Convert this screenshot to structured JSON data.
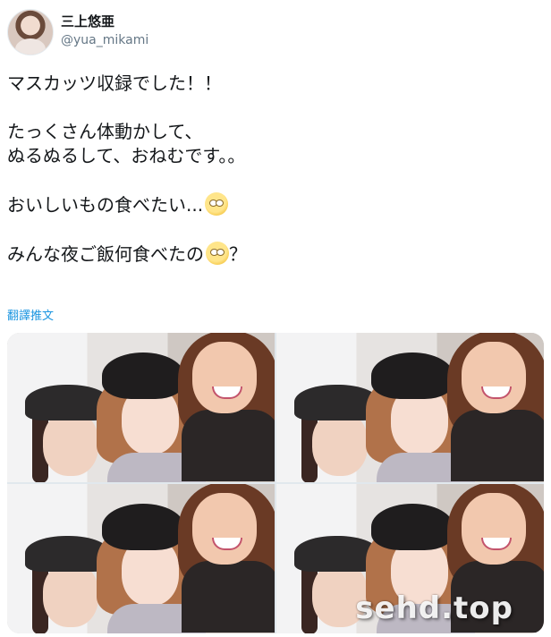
{
  "tweet": {
    "author_name": "三上悠亜",
    "author_handle": "@yua_mikami",
    "lines": [
      "マスカッツ収録でした！！",
      "たっくさん体動かして、",
      "ぬるぬるして、おねむです。。",
      "おいしいもの食べたい...",
      "みんな夜ご飯何食べたの",
      "？"
    ],
    "translate_label": "翻譯推文",
    "emoji_icon": "face-with-rolling-eyes-icon"
  },
  "media": {
    "photo_count": 4,
    "watermark": "sehd.top"
  }
}
